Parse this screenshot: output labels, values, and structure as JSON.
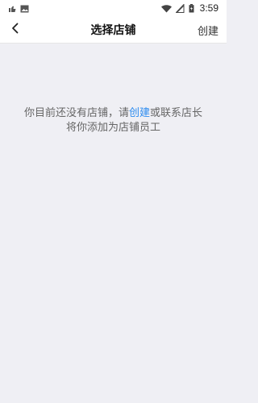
{
  "status_bar": {
    "time": "3:59",
    "left_icons": [
      "notification-icon",
      "gallery-icon"
    ],
    "right_icons": [
      "wifi-icon",
      "signal-icon",
      "battery-icon"
    ]
  },
  "nav": {
    "title": "选择店铺",
    "action_label": "创建",
    "back_icon": "chevron-left-icon"
  },
  "empty_state": {
    "line1_before": "你目前还没有店铺，请",
    "link_label": "创建",
    "line1_after": "或联系店长",
    "line2": "将你添加为店铺员工"
  },
  "colors": {
    "link": "#2d8cf0",
    "background": "#efeff4"
  }
}
